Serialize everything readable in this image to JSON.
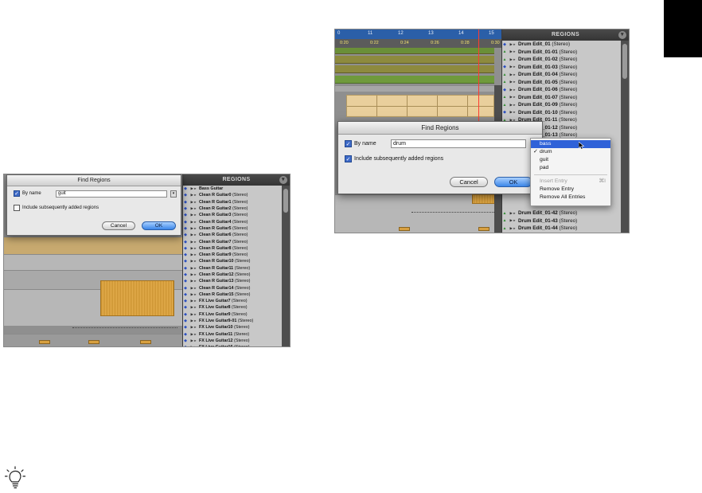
{
  "left_screenshot": {
    "dialog": {
      "title": "Find Regions",
      "by_name_label": "By name",
      "by_name_checked": true,
      "name_value": "guit",
      "include_label": "Include subsequently added regions",
      "include_checked": false,
      "cancel_label": "Cancel",
      "ok_label": "OK"
    },
    "regions": {
      "title": "REGIONS",
      "items": [
        {
          "name": "Bass Guitar",
          "suffix": ""
        },
        {
          "name": "Clean R Guitar0",
          "suffix": "(Stereo)"
        },
        {
          "name": "Clean R Guitar1",
          "suffix": "(Stereo)"
        },
        {
          "name": "Clean R Guitar2",
          "suffix": "(Stereo)"
        },
        {
          "name": "Clean R Guitar3",
          "suffix": "(Stereo)"
        },
        {
          "name": "Clean R Guitar4",
          "suffix": "(Stereo)"
        },
        {
          "name": "Clean R Guitar5",
          "suffix": "(Stereo)"
        },
        {
          "name": "Clean R Guitar6",
          "suffix": "(Stereo)"
        },
        {
          "name": "Clean R Guitar7",
          "suffix": "(Stereo)"
        },
        {
          "name": "Clean R Guitar8",
          "suffix": "(Stereo)"
        },
        {
          "name": "Clean R Guitar9",
          "suffix": "(Stereo)"
        },
        {
          "name": "Clean R Guitar10",
          "suffix": "(Stereo)"
        },
        {
          "name": "Clean R Guitar11",
          "suffix": "(Stereo)"
        },
        {
          "name": "Clean R Guitar12",
          "suffix": "(Stereo)"
        },
        {
          "name": "Clean R Guitar13",
          "suffix": "(Stereo)"
        },
        {
          "name": "Clean R Guitar14",
          "suffix": "(Stereo)"
        },
        {
          "name": "Clean R Guitar15",
          "suffix": "(Stereo)"
        },
        {
          "name": "FX Live Guitar7",
          "suffix": "(Stereo)"
        },
        {
          "name": "FX Live Guitar8",
          "suffix": "(Stereo)"
        },
        {
          "name": "FX Live Guitar9",
          "suffix": "(Stereo)"
        },
        {
          "name": "FX Live Guitar9-01",
          "suffix": "(Stereo)"
        },
        {
          "name": "FX Live Guitar10",
          "suffix": "(Stereo)"
        },
        {
          "name": "FX Live Guitar11",
          "suffix": "(Stereo)"
        },
        {
          "name": "FX Live Guitar12",
          "suffix": "(Stereo)"
        },
        {
          "name": "FX Live Guitar16",
          "suffix": "(Stereo)"
        },
        {
          "name": "R Guitar FX_02",
          "suffix": "(Stereo)"
        }
      ]
    }
  },
  "right_screenshot": {
    "ruler": {
      "bars": [
        "0",
        "11",
        "12",
        "13",
        "14",
        "15"
      ],
      "times": [
        "0:20",
        "0:22",
        "0:24",
        "0:26",
        "0:28",
        "0:30"
      ]
    },
    "dialog": {
      "title": "Find Regions",
      "by_name_label": "By name",
      "by_name_checked": true,
      "name_value": "drum",
      "include_label": "Include subsequently added regions",
      "include_checked": true,
      "cancel_label": "Cancel",
      "ok_label": "OK"
    },
    "dropdown": {
      "items": [
        {
          "label": "bass",
          "state": "highlighted"
        },
        {
          "label": "drum",
          "state": "checked"
        },
        {
          "label": "guit",
          "state": ""
        },
        {
          "label": "pad",
          "state": ""
        }
      ],
      "insert_entry": "Insert Entry",
      "insert_shortcut": "⌘I",
      "remove_entry": "Remove Entry",
      "remove_all": "Remove All Entries"
    },
    "regions": {
      "title": "REGIONS",
      "items": [
        {
          "name": "Drum Edit_01",
          "suffix": "(Stereo)"
        },
        {
          "name": "Drum Edit_01-01",
          "suffix": "(Stereo)"
        },
        {
          "name": "Drum Edit_01-02",
          "suffix": "(Stereo)"
        },
        {
          "name": "Drum Edit_01-03",
          "suffix": "(Stereo)"
        },
        {
          "name": "Drum Edit_01-04",
          "suffix": "(Stereo)"
        },
        {
          "name": "Drum Edit_01-05",
          "suffix": "(Stereo)"
        },
        {
          "name": "Drum Edit_01-06",
          "suffix": "(Stereo)"
        },
        {
          "name": "Drum Edit_01-07",
          "suffix": "(Stereo)"
        },
        {
          "name": "Drum Edit_01-09",
          "suffix": "(Stereo)"
        },
        {
          "name": "Drum Edit_01-10",
          "suffix": "(Stereo)"
        },
        {
          "name": "Drum Edit_01-11",
          "suffix": "(Stereo)"
        },
        {
          "name": "Drum Edit_01-12",
          "suffix": "(Stereo)"
        },
        {
          "name": "Drum Edit_01-13",
          "suffix": "(Stereo)"
        },
        {
          "name": "Drum Edit_01-14",
          "suffix": "(Stereo)"
        }
      ],
      "bottom_items": [
        {
          "name": "Drum Edit_01-42",
          "suffix": "(Stereo)"
        },
        {
          "name": "Drum Edit_01-43",
          "suffix": "(Stereo)"
        },
        {
          "name": "Drum Edit_01-44",
          "suffix": "(Stereo)"
        }
      ]
    }
  }
}
